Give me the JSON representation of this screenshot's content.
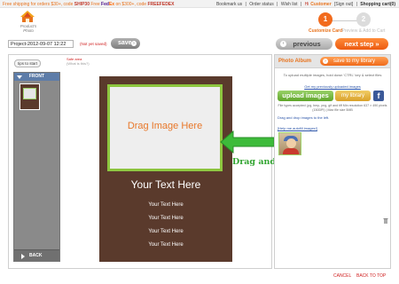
{
  "topbar": {
    "promo_prefix": "Free shipping for orders $30+, code ",
    "code1": "SHIP30",
    "promo_mid1": " Free ",
    "fedex_fe": "Fed",
    "fedex_ex": "Ex",
    "promo_mid2": " on $300+, code ",
    "code2": "FREEFEDEX",
    "bookmark": "Bookmark us",
    "order_status": "Order status",
    "wishlist": "Wish list",
    "hi": "Hi",
    "customer": "Customer",
    "sign_out": "[Sign out]",
    "cart": "Shopping cart(0)",
    "separator": "|"
  },
  "logo": {
    "text": "Product's Photo"
  },
  "steps": [
    {
      "num": "1",
      "label": "Customize Card"
    },
    {
      "num": "2",
      "label": "Preview & Add to Cart"
    }
  ],
  "project": {
    "name": "Project-2012-09-07 12:22",
    "status": "(Not yet saved)",
    "save_label": "save",
    "arrow": "›"
  },
  "nav": {
    "prev_label": "previous",
    "prev_arrow": "‹",
    "next_label": "next step »"
  },
  "editor": {
    "tips_label": "tips to start",
    "safe_area_title": "Safe area",
    "safe_area_sub": "(What is this?)",
    "pages_header": "FRONT",
    "back_label": "BACK"
  },
  "card": {
    "image_placeholder": "Drag Image Here",
    "main_text": "Your Text Here",
    "lines": [
      "Your Text Here",
      "Your Text Here",
      "Your Text Here",
      "Your Text Here"
    ],
    "drag_drop_label": "Drag and Drop"
  },
  "album": {
    "title": "Photo Album",
    "save_library": "save to my library",
    "upload_hint": "To upload multiple images, hold down 'CTRL' key & select files",
    "previous_link": "Get my previously uploaded images",
    "upload_label": "upload images",
    "mylibrary_label": "my library",
    "facebook_label": "f",
    "notes": "File types accepted: jpg, bmp, png, gif and tiff Min resolution 637 × 490 pixels (150DPI) | Max file size 5MB",
    "dnd_hint": "Drag and drop images to the left.",
    "help_link": "[Help me autofill images!]"
  },
  "footer": {
    "cancel": "CANCEL",
    "back_to_top": "BACK TO TOP"
  },
  "colors": {
    "accent": "#f26b1d",
    "card_bg": "#5a3a2c",
    "drop_border": "#8dc63f",
    "drag_arrow": "#33a532",
    "link_red": "#d02020"
  }
}
